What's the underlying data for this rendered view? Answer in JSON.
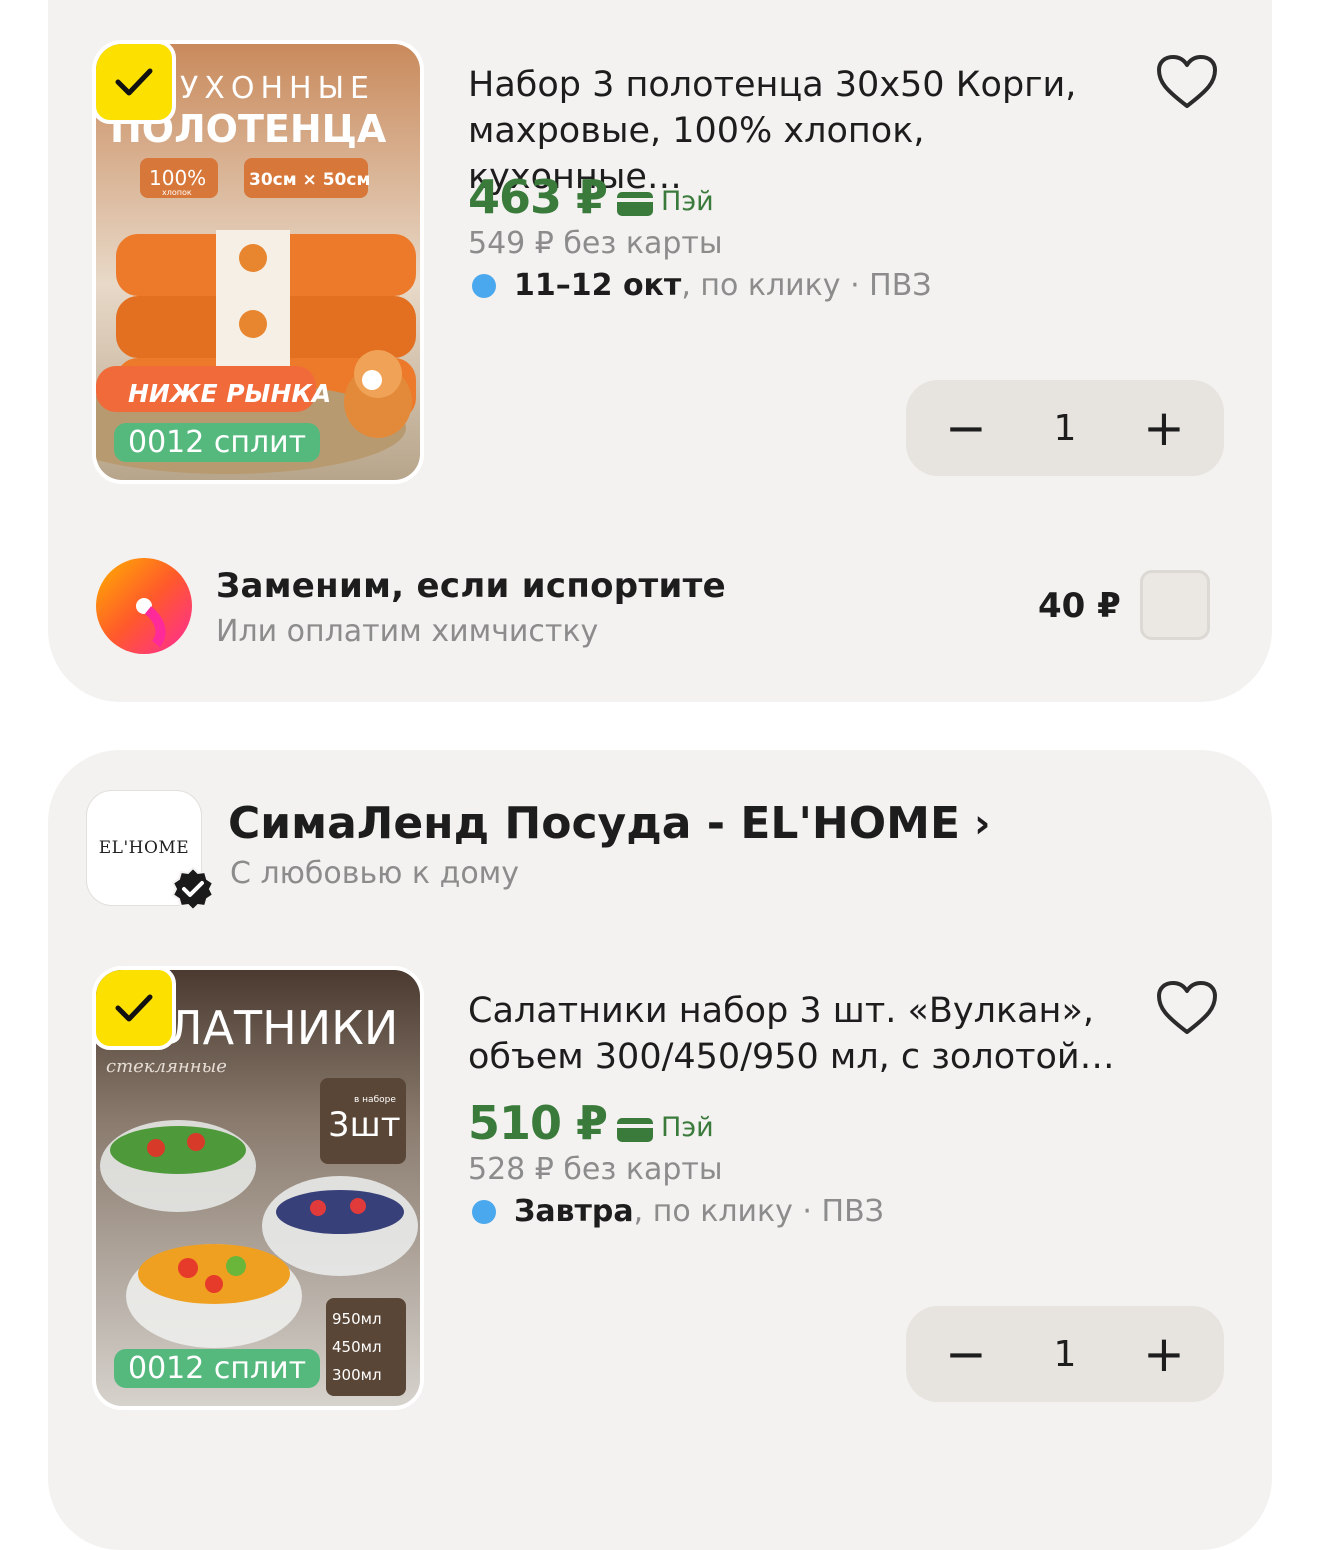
{
  "colors": {
    "card_bg": "#f3f2f0",
    "price_green": "#3a7a3b",
    "check_yellow": "#fce000",
    "split_green": "#55b97e",
    "delivery_dot": "#4aa8ee",
    "stepper_bg": "#e7e4df"
  },
  "product1": {
    "image_label": "towels-product-image",
    "image_text": {
      "line1": "УХОННЫЕ",
      "line2": "ПОЛОТЕНЦА",
      "badge_cotton": "100%",
      "badge_cotton_sub": "хлопок",
      "badge_size": "30см × 50см",
      "promo": "НИЖЕ РЫНКА"
    },
    "split_badge": "0012 сплит",
    "title": "Набор 3 полотенца 30х50 Корги, махровые, 100% хлопок, кухонные…",
    "price": "463 ₽",
    "pay_label": "Пэй",
    "old_price": "549 ₽ без карты",
    "delivery_date": "11–12 окт",
    "delivery_rest": ", по клику · ПВЗ",
    "quantity": "1",
    "minus": "−",
    "plus": "+"
  },
  "insurance": {
    "title": "Заменим, если испортите",
    "subtitle": "Или оплатим химчистку",
    "price": "40 ₽",
    "checked": false
  },
  "shop": {
    "logo_text": "EL'HOME",
    "name": "СимаЛенд Посуда - EL'HOME",
    "chevron": "›",
    "tagline": "С любовью к дому",
    "verified_icon": "verified-badge-icon"
  },
  "product2": {
    "image_label": "salad-bowls-product-image",
    "image_text": {
      "line1": "ЛАТНИКИ",
      "line2": "стеклянные",
      "badge_count": "3шт",
      "badge_count_sub": "в наборе",
      "volumes": [
        "950мл",
        "450мл",
        "300мл"
      ]
    },
    "split_badge": "0012 сплит",
    "title": "Салатники набор 3 шт. «Вулкан», объем 300/450/950 мл, с золотой…",
    "price": "510 ₽",
    "pay_label": "Пэй",
    "old_price": "528 ₽ без карты",
    "delivery_date": "Завтра",
    "delivery_rest": ", по клику · ПВЗ",
    "quantity": "1",
    "minus": "−",
    "plus": "+"
  }
}
